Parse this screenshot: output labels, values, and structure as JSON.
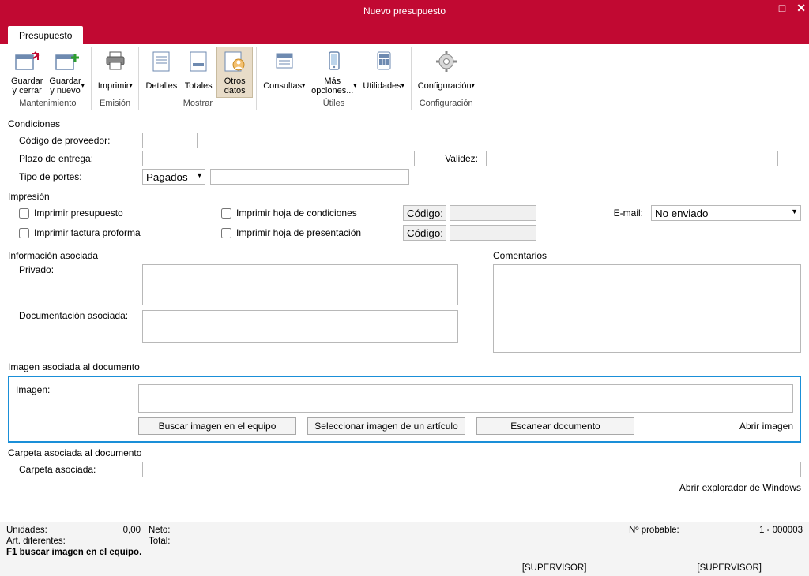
{
  "window": {
    "title": "Nuevo presupuesto"
  },
  "tab": {
    "label": "Presupuesto"
  },
  "ribbon": {
    "groups": {
      "mantenimiento": {
        "label": "Mantenimiento",
        "guardar_cerrar": "Guardar\ny cerrar",
        "guardar_nuevo": "Guardar\ny nuevo"
      },
      "emision": {
        "label": "Emisión",
        "imprimir": "Imprimir"
      },
      "mostrar": {
        "label": "Mostrar",
        "detalles": "Detalles",
        "totales": "Totales",
        "otros_datos": "Otros\ndatos"
      },
      "utiles": {
        "label": "Útiles",
        "consultas": "Consultas",
        "mas_opciones": "Más\nopciones...",
        "utilidades": "Utilidades"
      },
      "configuracion": {
        "label": "Configuración",
        "configuracion": "Configuración"
      }
    }
  },
  "sections": {
    "condiciones": "Condiciones",
    "impresion": "Impresión",
    "info_asociada": "Información asociada",
    "comentarios": "Comentarios",
    "imagen_doc": "Imagen asociada al documento",
    "carpeta_doc": "Carpeta asociada al documento"
  },
  "fields": {
    "codigo_proveedor": "Código de proveedor:",
    "plazo_entrega": "Plazo de entrega:",
    "validez": "Validez:",
    "tipo_portes": "Tipo de portes:",
    "tipo_portes_value": "Pagados",
    "privado": "Privado:",
    "doc_asociada": "Documentación asociada:",
    "imagen": "Imagen:",
    "carpeta": "Carpeta asociada:",
    "email": "E-mail:",
    "email_value": "No enviado",
    "codigo": "Código:"
  },
  "checks": {
    "presupuesto": "Imprimir presupuesto",
    "factura_proforma": "Imprimir factura proforma",
    "hoja_condiciones": "Imprimir hoja de condiciones",
    "hoja_presentacion": "Imprimir hoja de presentación"
  },
  "buttons": {
    "buscar_imagen": "Buscar imagen en el equipo",
    "sel_imagen_articulo": "Seleccionar imagen de un artículo",
    "escanear": "Escanear documento",
    "abrir_imagen": "Abrir imagen",
    "abrir_explorador": "Abrir explorador de Windows"
  },
  "footer": {
    "unidades_label": "Unidades:",
    "unidades_value": "0,00",
    "neto_label": "Neto:",
    "art_dif_label": "Art. diferentes:",
    "total_label": "Total:",
    "n_probable_label": "Nº probable:",
    "n_probable_value": "1 - 000003",
    "hint": "F1 buscar imagen en el equipo."
  },
  "status": {
    "left": "[SUPERVISOR]",
    "right": "[SUPERVISOR]"
  }
}
